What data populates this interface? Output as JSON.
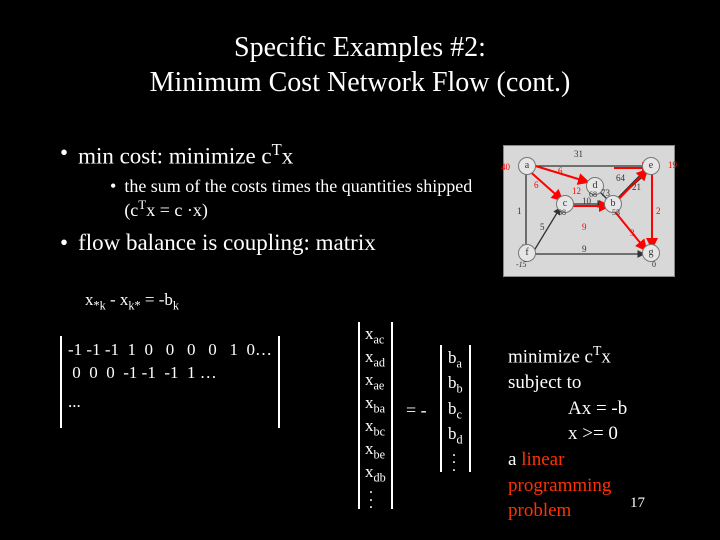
{
  "title_line1": "Specific Examples #2:",
  "title_line2": "Minimum Cost Network Flow (cont.)",
  "bullet1_pre": "min cost: minimize c",
  "bullet1_sup": "T",
  "bullet1_post": "x",
  "sub1_pre": "the sum of the costs times the quantities shipped (c",
  "sub1_sup": "T",
  "sub1_post": "x = c ·x)",
  "bullet2": "flow balance is coupling: matrix",
  "balance_eq": "x*k - xk* = -bk",
  "balance_pre": "x",
  "balance_s1": "*k",
  "balance_mid": " - x",
  "balance_s2": "k*",
  "balance_mid2": " = -b",
  "balance_s3": "k",
  "matrixA_row1": "-1 -1 -1  1  0   0   0   0   1  0…",
  "matrixA_row2": " 0  0  0  -1 -1  -1  1 …",
  "matrixA_row3": "...",
  "xvec": [
    "ac",
    "ad",
    "ae",
    "ba",
    "bc",
    "be",
    "db"
  ],
  "eqsign": "=  -",
  "bvec": [
    "a",
    "b",
    "c",
    "d"
  ],
  "lp_min_pre": "minimize c",
  "lp_min_sup": "T",
  "lp_min_post": "x",
  "lp_subj": "subject to",
  "lp_ax": "Ax = -b",
  "lp_xge": "x >= 0",
  "lp_a": "a ",
  "lp_red1": "linear",
  "lp_red2": "programming",
  "lp_red3": "problem",
  "pagenum": "17",
  "graph": {
    "nodes": {
      "a": "a",
      "b": "b",
      "c": "c",
      "d": "d",
      "e": "e",
      "f": "f",
      "g": "g"
    },
    "labels": {
      "a_in": "40",
      "ae": "31",
      "e_out": "19",
      "ac": "6",
      "ad": "6",
      "ad2": "12",
      "d_by": "68",
      "eb": "64",
      "db": "73",
      "be": "21",
      "fc": "5",
      "cb": "10",
      "c_by": "88",
      "b_by": "53",
      "af": "1",
      "bg": "3",
      "eg": "2",
      "fg": "9",
      "cb_b": "9",
      "f_val": "-15",
      "g_val": "0"
    }
  }
}
